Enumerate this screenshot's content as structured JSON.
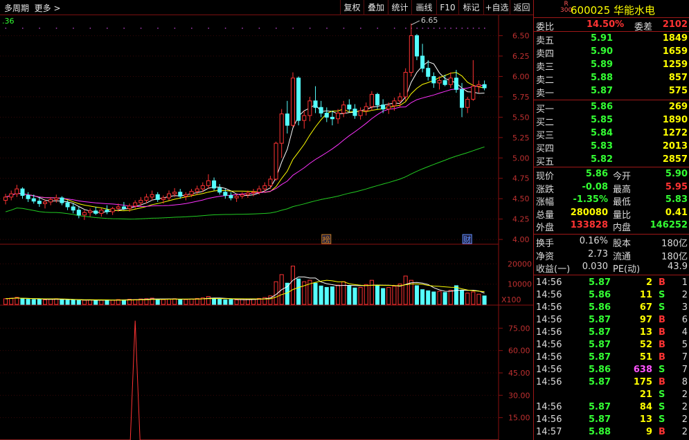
{
  "toolbar": {
    "period": "多周期",
    "more": "更多",
    "buttons": [
      "复权",
      "叠加",
      "统计",
      "画线",
      "F10",
      "标记",
      "+自选",
      "返回"
    ]
  },
  "chart": {
    "corner_value": ".36",
    "high_marker": "6.65",
    "price_axis": [
      "6.50",
      "6.25",
      "6.00",
      "5.75",
      "5.50",
      "5.25",
      "5.00",
      "4.75",
      "4.50",
      "4.25",
      "4.00"
    ],
    "event_markers": [
      {
        "label": "榜",
        "color": "#d08020"
      },
      {
        "label": "财",
        "color": "#6090ff"
      }
    ],
    "volume_axis": [
      "20000",
      "10000"
    ],
    "volume_unit": "X100",
    "indicator_axis": [
      "75.00",
      "60.00",
      "45.00",
      "30.00",
      "15.00"
    ]
  },
  "chart_data": {
    "type": "candlestick",
    "y_range": [
      3.95,
      6.7
    ],
    "ohlc": [
      [
        4.48,
        4.56,
        4.43,
        4.52
      ],
      [
        4.52,
        4.6,
        4.48,
        4.56
      ],
      [
        4.56,
        4.67,
        4.52,
        4.62
      ],
      [
        4.62,
        4.64,
        4.5,
        4.54
      ],
      [
        4.54,
        4.58,
        4.46,
        4.5
      ],
      [
        4.5,
        4.55,
        4.44,
        4.47
      ],
      [
        4.47,
        4.52,
        4.4,
        4.44
      ],
      [
        4.44,
        4.49,
        4.38,
        4.46
      ],
      [
        4.46,
        4.52,
        4.42,
        4.49
      ],
      [
        4.49,
        4.55,
        4.45,
        4.51
      ],
      [
        4.51,
        4.53,
        4.42,
        4.45
      ],
      [
        4.45,
        4.48,
        4.36,
        4.4
      ],
      [
        4.4,
        4.44,
        4.32,
        4.36
      ],
      [
        4.36,
        4.4,
        4.26,
        4.3
      ],
      [
        4.3,
        4.36,
        4.24,
        4.33
      ],
      [
        4.33,
        4.38,
        4.28,
        4.35
      ],
      [
        4.35,
        4.4,
        4.3,
        4.32
      ],
      [
        4.32,
        4.38,
        4.28,
        4.36
      ],
      [
        4.36,
        4.42,
        4.31,
        4.34
      ],
      [
        4.34,
        4.4,
        4.3,
        4.38
      ],
      [
        4.38,
        4.44,
        4.34,
        4.4
      ],
      [
        4.4,
        4.46,
        4.36,
        4.38
      ],
      [
        4.38,
        4.44,
        4.34,
        4.41
      ],
      [
        4.41,
        4.48,
        4.38,
        4.45
      ],
      [
        4.45,
        4.52,
        4.41,
        4.48
      ],
      [
        4.48,
        4.56,
        4.44,
        4.52
      ],
      [
        4.52,
        4.6,
        4.48,
        4.55
      ],
      [
        4.55,
        4.58,
        4.46,
        4.49
      ],
      [
        4.49,
        4.54,
        4.44,
        4.51
      ],
      [
        4.51,
        4.6,
        4.48,
        4.56
      ],
      [
        4.56,
        4.63,
        4.52,
        4.58
      ],
      [
        4.58,
        4.62,
        4.5,
        4.53
      ],
      [
        4.53,
        4.58,
        4.48,
        4.55
      ],
      [
        4.55,
        4.62,
        4.52,
        4.59
      ],
      [
        4.59,
        4.66,
        4.55,
        4.62
      ],
      [
        4.62,
        4.7,
        4.58,
        4.66
      ],
      [
        4.66,
        4.8,
        4.62,
        4.72
      ],
      [
        4.72,
        4.76,
        4.6,
        4.63
      ],
      [
        4.63,
        4.68,
        4.55,
        4.58
      ],
      [
        4.58,
        4.62,
        4.5,
        4.54
      ],
      [
        4.54,
        4.58,
        4.48,
        4.51
      ],
      [
        4.51,
        4.56,
        4.46,
        4.53
      ],
      [
        4.53,
        4.58,
        4.5,
        4.55
      ],
      [
        4.55,
        4.6,
        4.51,
        4.57
      ],
      [
        4.57,
        4.62,
        4.53,
        4.58
      ],
      [
        4.58,
        4.66,
        4.55,
        4.62
      ],
      [
        4.62,
        4.7,
        4.58,
        4.66
      ],
      [
        4.66,
        4.78,
        4.62,
        4.74
      ],
      [
        4.74,
        5.2,
        4.72,
        5.18
      ],
      [
        5.18,
        5.6,
        5.0,
        5.54
      ],
      [
        5.54,
        5.7,
        5.3,
        5.4
      ],
      [
        5.4,
        6.05,
        5.38,
        5.98
      ],
      [
        5.98,
        6.0,
        5.4,
        5.46
      ],
      [
        5.46,
        5.58,
        5.36,
        5.52
      ],
      [
        5.52,
        5.75,
        5.45,
        5.7
      ],
      [
        5.7,
        5.88,
        5.55,
        5.62
      ],
      [
        5.62,
        5.7,
        5.5,
        5.55
      ],
      [
        5.55,
        5.62,
        5.44,
        5.5
      ],
      [
        5.5,
        5.58,
        5.4,
        5.48
      ],
      [
        5.48,
        5.6,
        5.42,
        5.55
      ],
      [
        5.55,
        5.7,
        5.5,
        5.65
      ],
      [
        5.65,
        5.72,
        5.56,
        5.6
      ],
      [
        5.6,
        5.66,
        5.48,
        5.52
      ],
      [
        5.52,
        5.62,
        5.47,
        5.58
      ],
      [
        5.58,
        5.68,
        5.52,
        5.63
      ],
      [
        5.63,
        5.82,
        5.58,
        5.78
      ],
      [
        5.78,
        5.8,
        5.6,
        5.65
      ],
      [
        5.65,
        5.72,
        5.55,
        5.6
      ],
      [
        5.6,
        5.68,
        5.54,
        5.64
      ],
      [
        5.64,
        5.74,
        5.58,
        5.7
      ],
      [
        5.7,
        5.8,
        5.62,
        5.75
      ],
      [
        5.75,
        6.1,
        5.7,
        6.05
      ],
      [
        6.05,
        6.65,
        6.0,
        6.5
      ],
      [
        6.5,
        6.52,
        6.2,
        6.25
      ],
      [
        6.25,
        6.4,
        6.05,
        6.1
      ],
      [
        6.1,
        6.2,
        5.95,
        6.0
      ],
      [
        6.0,
        6.05,
        5.86,
        5.92
      ],
      [
        5.92,
        6.0,
        5.84,
        5.95
      ],
      [
        5.95,
        6.02,
        5.88,
        5.9
      ],
      [
        5.9,
        6.05,
        5.86,
        5.98
      ],
      [
        5.98,
        6.08,
        5.8,
        5.84
      ],
      [
        5.84,
        5.92,
        5.5,
        5.62
      ],
      [
        5.62,
        5.75,
        5.55,
        5.72
      ],
      [
        5.72,
        6.2,
        5.7,
        5.88
      ],
      [
        5.88,
        5.95,
        5.8,
        5.9
      ],
      [
        5.9,
        5.95,
        5.83,
        5.86
      ]
    ],
    "volume": [
      2,
      2.2,
      2.5,
      2,
      1.8,
      1.7,
      1.9,
      1.6,
      1.8,
      2,
      1.7,
      1.5,
      1.6,
      1.4,
      1.5,
      1.6,
      1.4,
      1.5,
      1.6,
      1.5,
      1.7,
      1.6,
      1.8,
      1.7,
      1.9,
      2,
      2.2,
      1.8,
      1.7,
      1.9,
      2,
      1.8,
      1.7,
      1.9,
      2.1,
      2.3,
      2.8,
      2.2,
      1.8,
      1.6,
      1.7,
      1.6,
      1.7,
      1.8,
      1.9,
      2.1,
      2.4,
      3,
      8,
      10.5,
      7.5,
      13.5,
      9,
      8,
      8.5,
      7.5,
      6.5,
      6,
      6.2,
      6.8,
      8,
      6.5,
      5.8,
      6,
      7,
      8.5,
      6.8,
      5.6,
      6,
      6.4,
      7.2,
      10,
      8.5,
      6.6,
      5.2,
      4.8,
      4.4,
      4.6,
      4.2,
      5,
      6.6,
      5,
      4,
      4.4,
      3.6,
      3
    ],
    "indicator_peak": {
      "index": 23,
      "value": 80
    },
    "volume_range": [
      0,
      28000
    ],
    "indicator_range": [
      0,
      90
    ]
  },
  "quote": {
    "badge_r": "R",
    "badge_300": "300",
    "code_name": "600025 华能水电",
    "weibi_label": "委比",
    "weibi_value": "14.50%",
    "weicha_label": "委差",
    "weicha_value": "2102",
    "sell": [
      {
        "label": "卖五",
        "price": "5.91",
        "vol": "1849"
      },
      {
        "label": "卖四",
        "price": "5.90",
        "vol": "1659"
      },
      {
        "label": "卖三",
        "price": "5.89",
        "vol": "1259"
      },
      {
        "label": "卖二",
        "price": "5.88",
        "vol": "857"
      },
      {
        "label": "卖一",
        "price": "5.87",
        "vol": "575"
      }
    ],
    "buy": [
      {
        "label": "买一",
        "price": "5.86",
        "vol": "269"
      },
      {
        "label": "买二",
        "price": "5.85",
        "vol": "1890"
      },
      {
        "label": "买三",
        "price": "5.84",
        "vol": "1272"
      },
      {
        "label": "买四",
        "price": "5.83",
        "vol": "2013"
      },
      {
        "label": "买五",
        "price": "5.82",
        "vol": "2857"
      }
    ],
    "stats": [
      {
        "l1": "现价",
        "v1": "5.86",
        "c1": "g",
        "l2": "今开",
        "v2": "5.90",
        "c2": "g"
      },
      {
        "l1": "涨跌",
        "v1": "-0.08",
        "c1": "g",
        "l2": "最高",
        "v2": "5.95",
        "c2": "r"
      },
      {
        "l1": "涨幅",
        "v1": "-1.35%",
        "c1": "g",
        "l2": "最低",
        "v2": "5.83",
        "c2": "g"
      },
      {
        "l1": "总量",
        "v1": "280080",
        "c1": "y",
        "l2": "量比",
        "v2": "0.41",
        "c2": "y"
      },
      {
        "l1": "外盘",
        "v1": "133828",
        "c1": "r",
        "l2": "内盘",
        "v2": "146252",
        "c2": "g"
      }
    ],
    "fundamentals": [
      {
        "l1": "换手",
        "v1": "0.16%",
        "l2": "股本",
        "v2": "180亿"
      },
      {
        "l1": "净资",
        "v1": "2.73",
        "l2": "流通",
        "v2": "180亿"
      },
      {
        "l1": "收益(一)",
        "v1": "0.030",
        "l2": "PE(动)",
        "v2": "43.9"
      }
    ],
    "ticks": [
      {
        "t": "14:56",
        "p": "5.87",
        "v": "2",
        "s": "B",
        "n": "1"
      },
      {
        "t": "14:56",
        "p": "5.86",
        "v": "11",
        "s": "S",
        "n": "2"
      },
      {
        "t": "14:56",
        "p": "5.86",
        "v": "67",
        "s": "S",
        "n": "3"
      },
      {
        "t": "14:56",
        "p": "5.87",
        "v": "97",
        "s": "B",
        "n": "6"
      },
      {
        "t": "14:56",
        "p": "5.87",
        "v": "13",
        "s": "B",
        "n": "4"
      },
      {
        "t": "14:56",
        "p": "5.87",
        "v": "52",
        "s": "B",
        "n": "5"
      },
      {
        "t": "14:56",
        "p": "5.87",
        "v": "51",
        "s": "B",
        "n": "7"
      },
      {
        "t": "14:56",
        "p": "5.86",
        "v": "638",
        "s": "S",
        "n": "7"
      },
      {
        "t": "14:56",
        "p": "5.87",
        "v": "175",
        "s": "B",
        "n": "8"
      },
      {
        "t": "",
        "p": "",
        "v": "21",
        "s": "S",
        "n": "2"
      },
      {
        "t": "14:56",
        "p": "5.87",
        "v": "84",
        "s": "S",
        "n": "2"
      },
      {
        "t": "14:56",
        "p": "5.87",
        "v": "13",
        "s": "S",
        "n": "2"
      },
      {
        "t": "14:57",
        "p": "5.88",
        "v": "9",
        "s": "B",
        "n": "2"
      }
    ]
  }
}
